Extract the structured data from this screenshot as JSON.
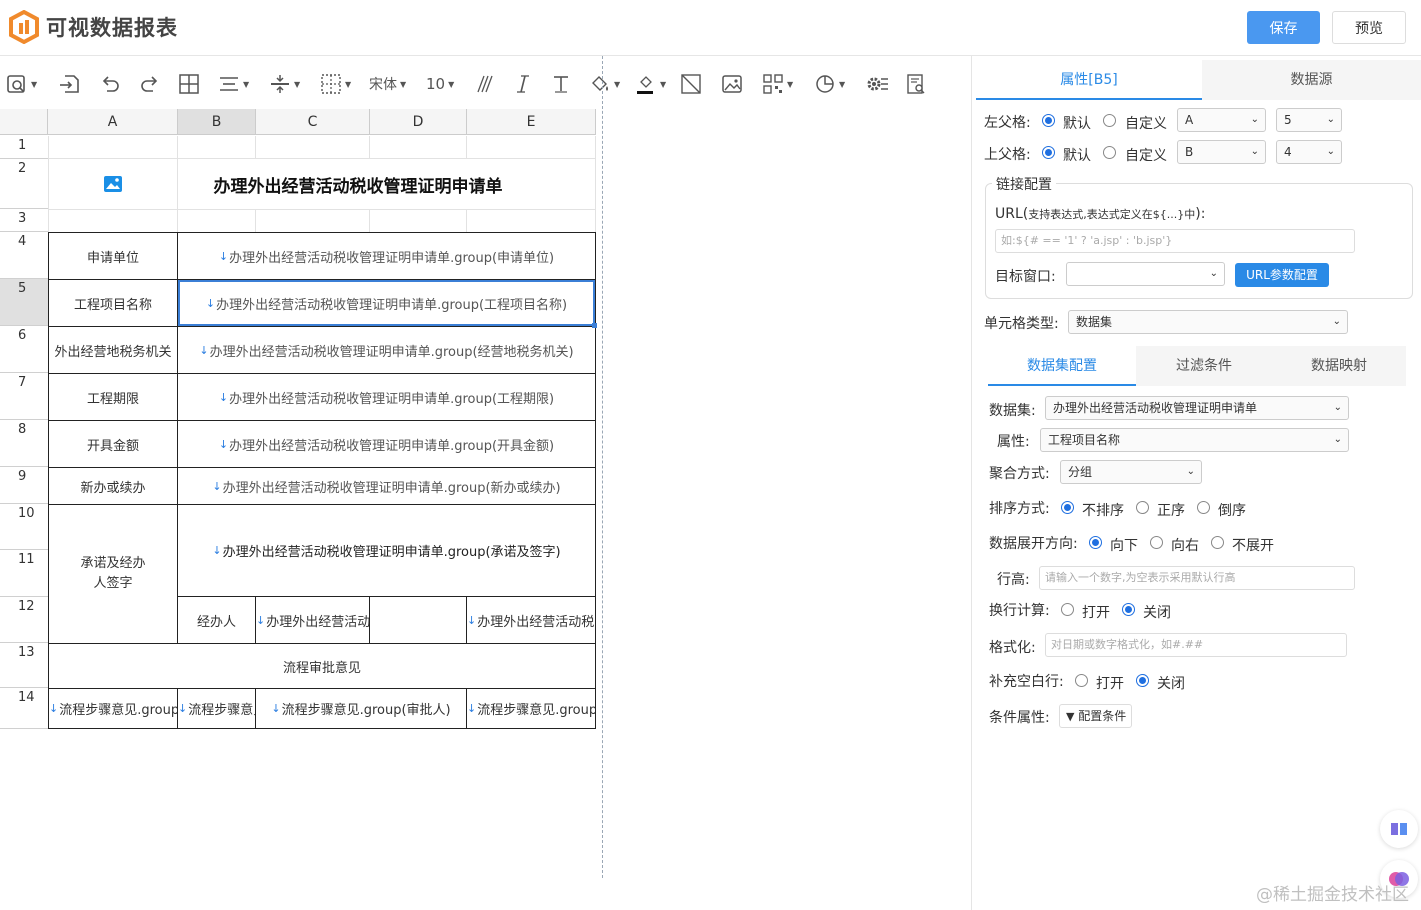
{
  "app": {
    "title": "可视数据报表",
    "save_label": "保存",
    "preview_label": "预览"
  },
  "toolbar": {
    "font_name": "宋体",
    "font_size": "10"
  },
  "grid": {
    "columns": [
      "A",
      "B",
      "C",
      "D",
      "E"
    ],
    "rows": [
      "1",
      "2",
      "3",
      "4",
      "5",
      "6",
      "7",
      "8",
      "9",
      "10",
      "11",
      "12",
      "13",
      "14"
    ],
    "title": "办理外出经营活动税收管理证明申请单",
    "labels": {
      "r4": "申请单位",
      "r5": "工程项目名称",
      "r6": "外出经营地税务机关",
      "r7": "工程期限",
      "r8": "开具金额",
      "r9": "新办或续办",
      "r10": "承诺及经办人签字",
      "r12b": "经办人",
      "r13": "流程审批意见"
    },
    "exprs": {
      "r4": "办理外出经营活动税收管理证明申请单.group(申请单位)",
      "r5": "办理外出经营活动税收管理证明申请单.group(工程项目名称)",
      "r6": "办理外出经营活动税收管理证明申请单.group(经营地税务机关)",
      "r7": "办理外出经营活动税收管理证明申请单.group(工程期限)",
      "r8": "办理外出经营活动税收管理证明申请单.group(开具金额)",
      "r9": "办理外出经营活动税收管理证明申请单.group(新办或续办)",
      "r10": "办理外出经营活动税收管理证明申请单.group(承诺及签字)",
      "r12c": "办理外出经营活动税",
      "r12e": "办理外出经营活动税收",
      "r14a": "流程步骤意见.group(流",
      "r14b": "流程步骤意见",
      "r14c": "流程步骤意见.group(审批人)",
      "r14e": "流程步骤意见.group(处"
    }
  },
  "panel": {
    "tabs": [
      "属性[B5]",
      "数据源"
    ],
    "left_parent": {
      "label": "左父格:",
      "opt_default": "默认",
      "opt_custom": "自定义",
      "col": "A",
      "row": "5"
    },
    "top_parent": {
      "label": "上父格:",
      "opt_default": "默认",
      "opt_custom": "自定义",
      "col": "B",
      "row": "4"
    },
    "link": {
      "legend": "链接配置",
      "url_label": "URL(",
      "url_hint": "支持表达式,表达式定义在${...}中",
      "url_label_end": "):",
      "url_placeholder": "如:${# == '1' ? 'a.jsp' : 'b.jsp'}",
      "target_label": "目标窗口:",
      "target_value": "",
      "url_params_btn": "URL参数配置"
    },
    "cell_type": {
      "label": "单元格类型:",
      "value": "数据集"
    },
    "subtabs": [
      "数据集配置",
      "过滤条件",
      "数据映射"
    ],
    "dataset": {
      "label": "数据集:",
      "value": "办理外出经营活动税收管理证明申请单"
    },
    "attribute": {
      "label": "属性:",
      "value": "工程项目名称"
    },
    "aggregate": {
      "label": "聚合方式:",
      "value": "分组"
    },
    "sort": {
      "label": "排序方式:",
      "options": [
        "不排序",
        "正序",
        "倒序"
      ],
      "selected": "不排序"
    },
    "expand": {
      "label": "数据展开方向:",
      "options": [
        "向下",
        "向右",
        "不展开"
      ],
      "selected": "向下"
    },
    "row_height": {
      "label": "行高:",
      "placeholder": "请输入一个数字,为空表示采用默认行高"
    },
    "wrap": {
      "label": "换行计算:",
      "options": [
        "打开",
        "关闭"
      ],
      "selected": "关闭"
    },
    "format": {
      "label": "格式化:",
      "placeholder": "对日期或数字格式化，如#.##"
    },
    "fill_blank": {
      "label": "补充空白行:",
      "options": [
        "打开",
        "关闭"
      ],
      "selected": "关闭"
    },
    "condition": {
      "label": "条件属性:",
      "button": "配置条件"
    }
  },
  "watermark": "@稀土掘金技术社区",
  "colors": {
    "accent": "#2a8ae6",
    "save": "#4a98f0"
  }
}
